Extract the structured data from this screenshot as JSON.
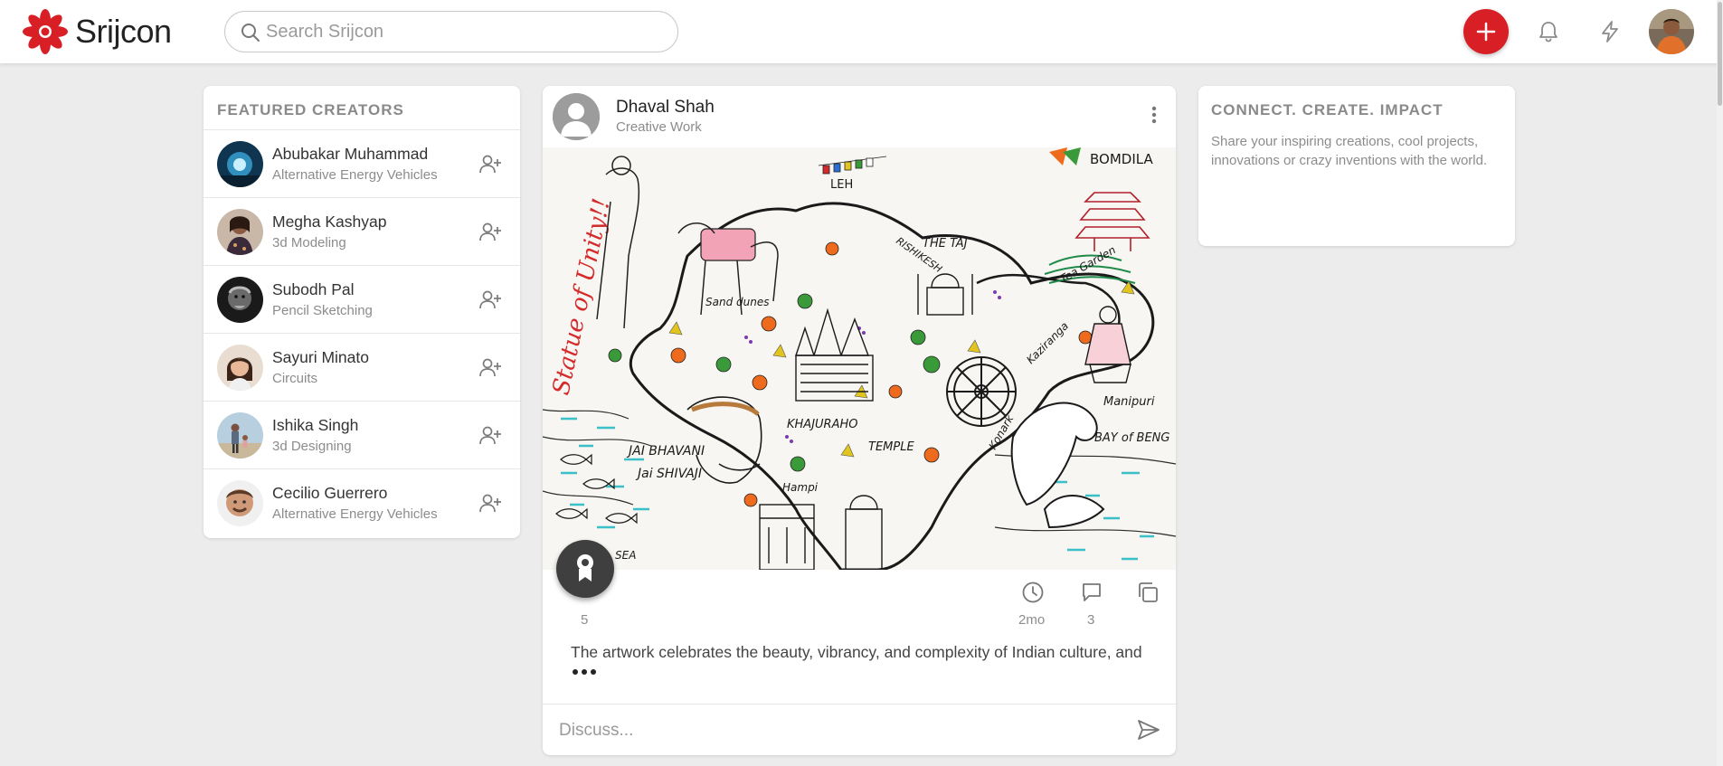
{
  "colors": {
    "accent": "#d71f25",
    "background": "#ececec",
    "card": "#ffffff",
    "muted": "#8c8c8c"
  },
  "header": {
    "brand": "Srijcon",
    "logo_icon": "lotus-logo-icon",
    "search_placeholder": "Search Srijcon",
    "create_icon": "plus-icon",
    "notifications_icon": "bell-icon",
    "activity_icon": "lightning-bolt-icon",
    "avatar_icon": "user-avatar"
  },
  "featured": {
    "title": "FEATURED CREATORS",
    "creators": [
      {
        "name": "Abubakar Muhammad",
        "category": "Alternative Energy Vehicles",
        "avatar_color": "#2a6f9c"
      },
      {
        "name": "Megha Kashyap",
        "category": "3d Modeling",
        "avatar_color": "#8a5a4a"
      },
      {
        "name": "Subodh Pal",
        "category": "Pencil Sketching",
        "avatar_color": "#3a3a3a"
      },
      {
        "name": "Sayuri Minato",
        "category": "Circuits",
        "avatar_color": "#b07a5a"
      },
      {
        "name": "Ishika Singh",
        "category": "3d Designing",
        "avatar_color": "#7c9cb8"
      },
      {
        "name": "Cecilio Guerrero",
        "category": "Alternative Energy Vehicles",
        "avatar_color": "#c08a6a"
      }
    ]
  },
  "post": {
    "author": "Dhaval Shah",
    "category": "Creative Work",
    "award_count": "5",
    "time_ago": "2mo",
    "comment_count": "3",
    "description": "The artwork celebrates the beauty, vibrancy, and complexity of Indian culture, and",
    "discuss_placeholder": "Discuss...",
    "art_labels": {
      "leh": "LEH",
      "bomdila": "BOMDILA",
      "taj": "THE TAJ",
      "statue": "Statue of Unity!!",
      "khajuraho": "KHAJURAHO",
      "temple": "TEMPLE",
      "jai_bhavani": "JAI BHAVANI",
      "jai_shivaji": "Jai SHIVAJI",
      "sand_dunes": "Sand dunes",
      "tea_garden": "Tea Garden",
      "manipuri": "Manipuri",
      "bay_of_bengal": "BAY of BENG",
      "rishikesh": "RISHIKESH",
      "hampi": "Hampi",
      "sea": "SEA",
      "kaziranga": "Kaziranga",
      "konark": "Konark"
    }
  },
  "promo": {
    "title": "CONNECT. CREATE. IMPACT",
    "text": "Share your inspiring creations, cool projects, innovations or crazy inventions with the world."
  }
}
